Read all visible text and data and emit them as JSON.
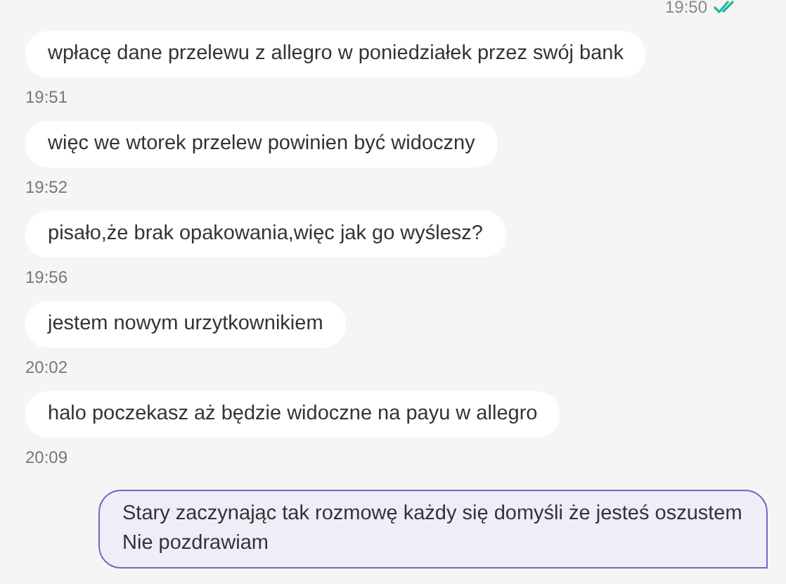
{
  "previous_message_status": {
    "time": "19:50",
    "read": true
  },
  "messages": [
    {
      "kind": "received",
      "text": "wpłacę dane przelewu z allegro w poniedziałek przez swój bank",
      "time": "19:51"
    },
    {
      "kind": "received",
      "text": "więc we wtorek przelew powinien być widoczny",
      "time": "19:52"
    },
    {
      "kind": "received",
      "text": "pisało,że brak opakowania,więc jak go wyślesz?",
      "time": "19:56"
    },
    {
      "kind": "received",
      "text": "jestem nowym urzytkownikiem",
      "time": "20:02"
    },
    {
      "kind": "received",
      "text": "halo poczekasz aż będzie widoczne na payu w allegro",
      "time": "20:09"
    },
    {
      "kind": "sent",
      "text": "Stary zaczynając tak rozmowę każdy się domyśli że jesteś oszustem Nie pozdrawiam"
    }
  ]
}
